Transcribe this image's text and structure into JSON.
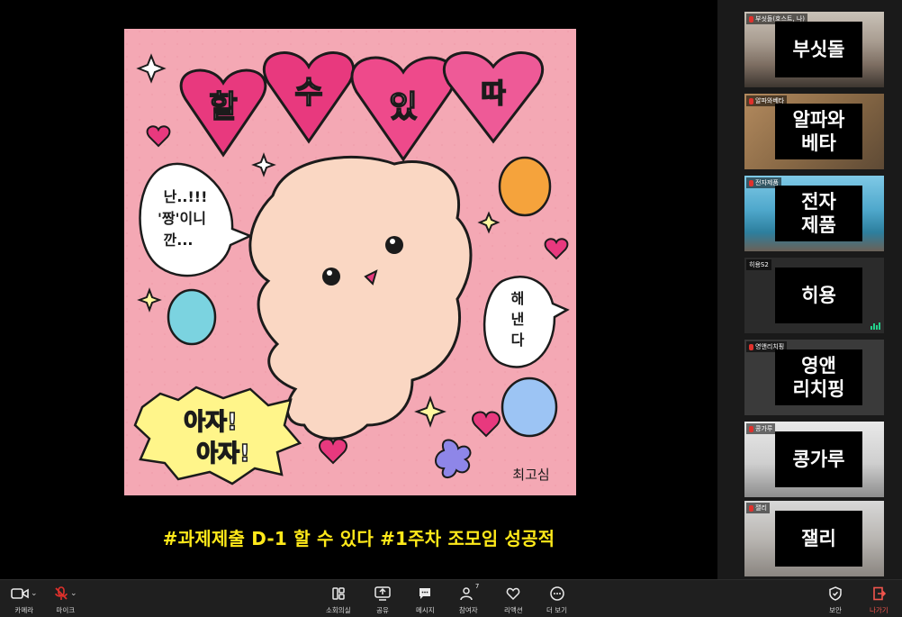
{
  "shared": {
    "caption": "#과제제출 D-1 할 수 있다 #1주차 조모임 성공적",
    "image": {
      "heart_title": [
        "할",
        "수",
        "있",
        "따"
      ],
      "left_bubble": "난..!!!\n'짱'이니\n깐...",
      "right_bubble": "해\n낸\n다",
      "cheer": "아자!\n아자!",
      "signature": "최고심"
    }
  },
  "participants": [
    {
      "label": "부싯돌(호스트, 나)",
      "nickname": "부싯돌",
      "muted": true,
      "active": false
    },
    {
      "label": "알파와베타",
      "nickname": "알파와\n베타",
      "muted": true,
      "active": false
    },
    {
      "label": "전자제품",
      "nickname": "전자\n제품",
      "muted": true,
      "active": false
    },
    {
      "label": "히용S2",
      "nickname": "히용",
      "muted": false,
      "active": true
    },
    {
      "label": "영앤리치핑",
      "nickname": "영앤\n리치핑",
      "muted": true,
      "active": false
    },
    {
      "label": "콩가루",
      "nickname": "콩가루",
      "muted": true,
      "active": false
    },
    {
      "label": "잴리",
      "nickname": "잴리",
      "muted": true,
      "active": false
    }
  ],
  "toolbar": {
    "camera": "카메라",
    "mic": "마이크",
    "breakout": "소회의실",
    "share": "공유",
    "chat": "메시지",
    "participants": "참여자",
    "participants_count": "7",
    "reactions": "리액션",
    "more": "더 보기",
    "security": "보안",
    "leave": "나가기"
  },
  "colors": {
    "caption": "#ffe91a",
    "active_speaker": "#23d18b",
    "leave": "#f2554d",
    "image_bg": "#f4a8b4"
  }
}
